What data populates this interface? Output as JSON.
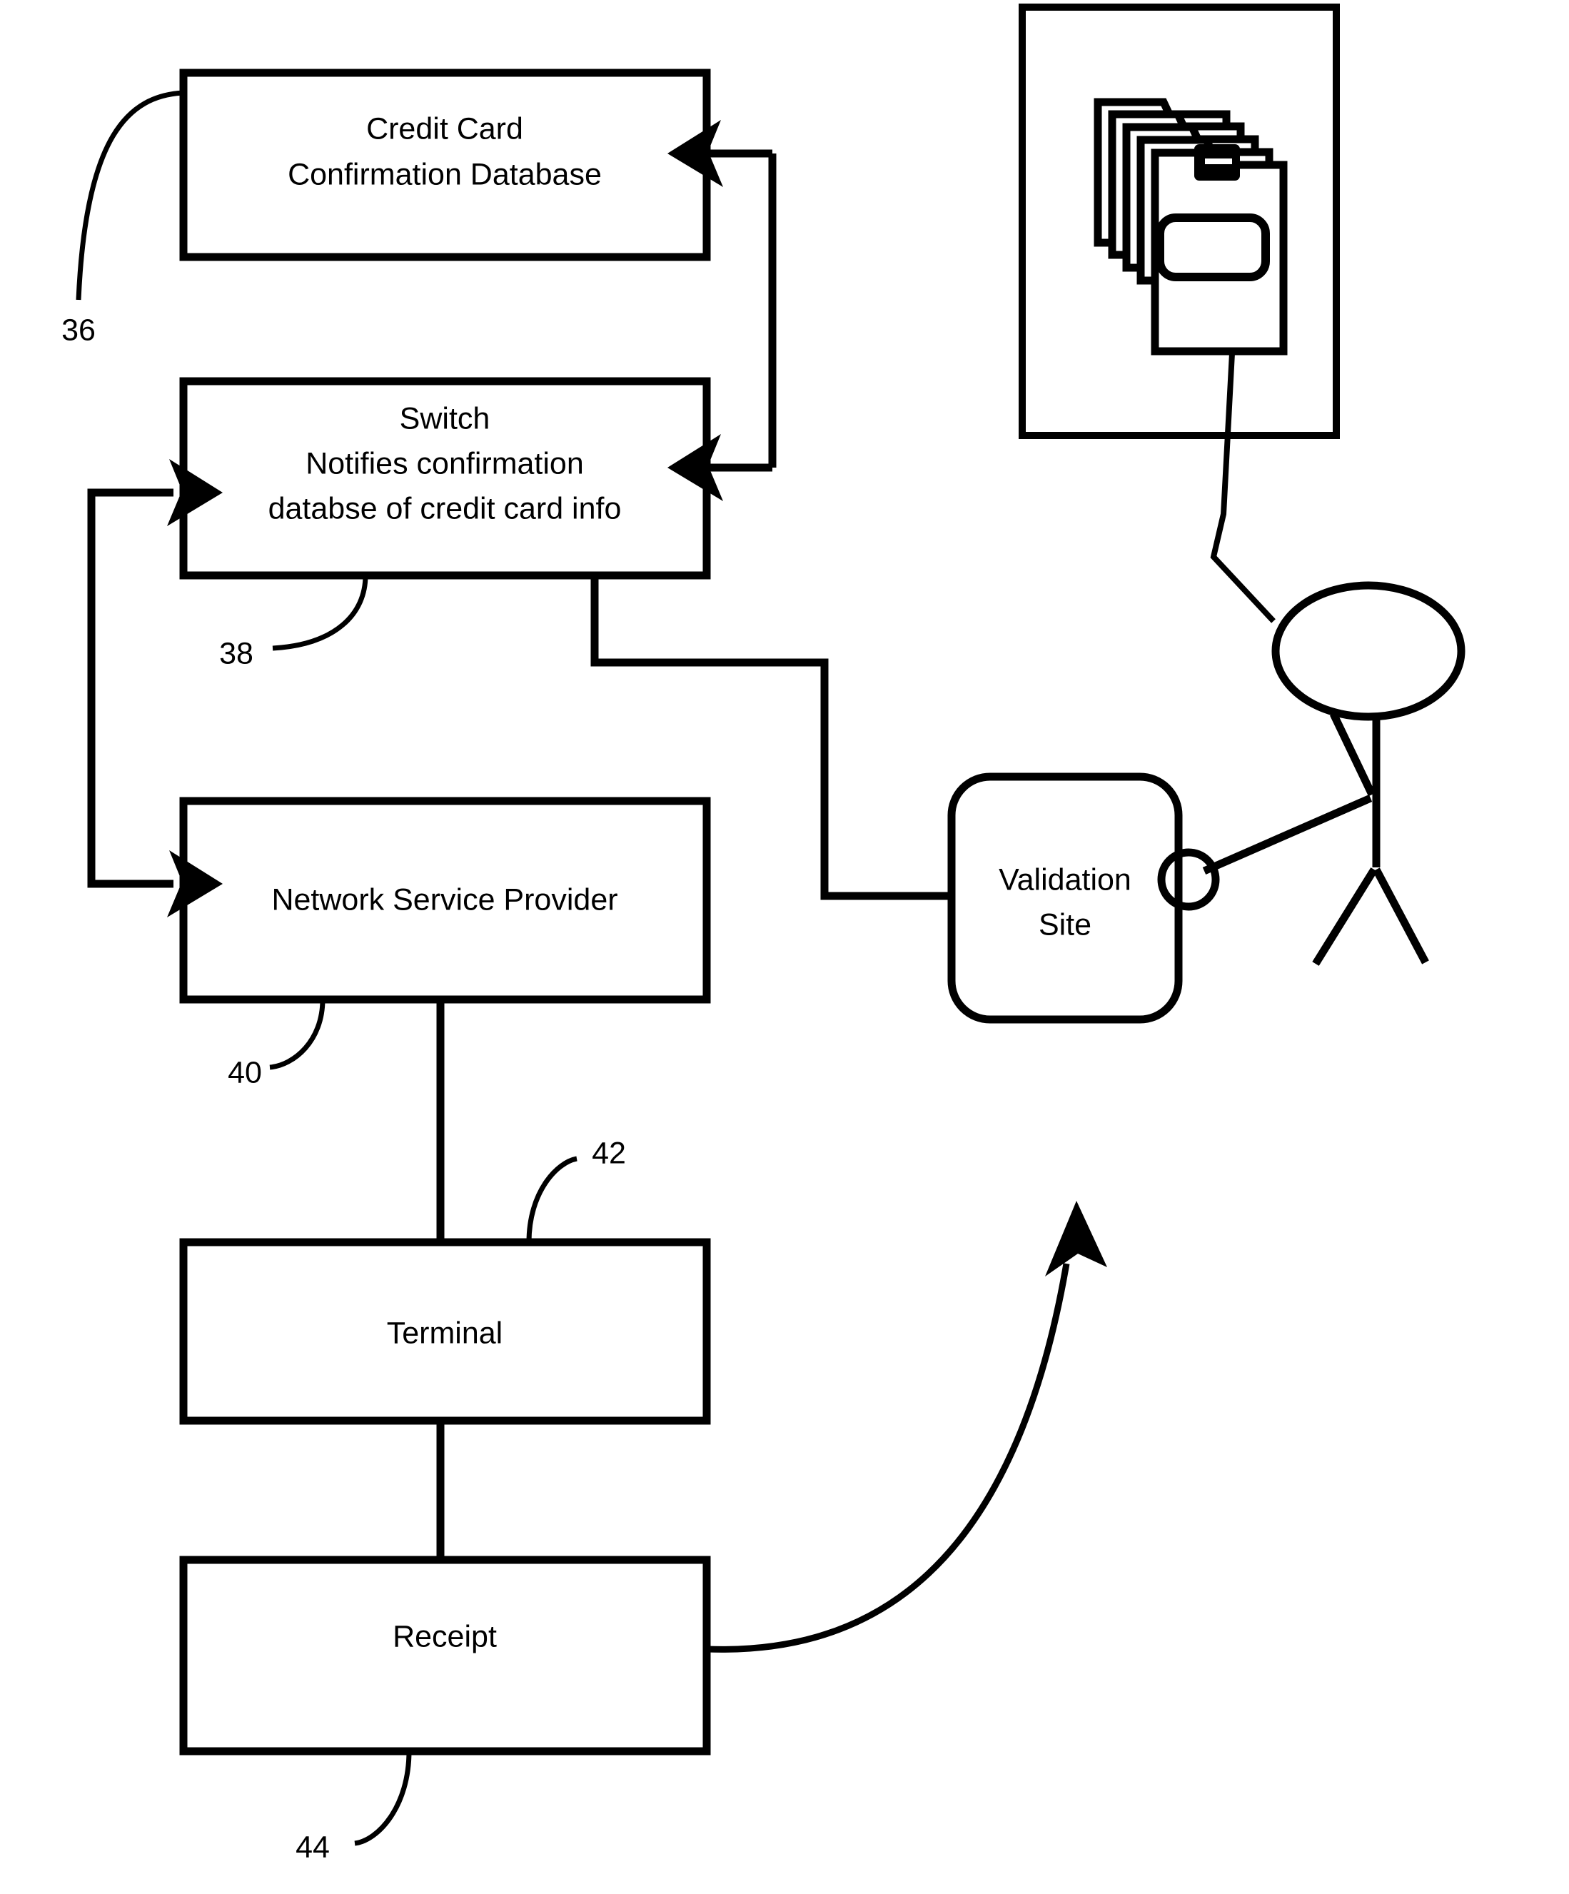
{
  "figure": {
    "type": "patent-flow-diagram",
    "background_color": "#ffffff",
    "line_color": "#000000"
  },
  "nodes": {
    "credit_card_db": {
      "label_line1": "Credit Card",
      "label_line2": "Confirmation Database",
      "ref": "36",
      "shape": "rectangle"
    },
    "switch": {
      "label_line1": "Switch",
      "label_line2": "Notifies confirmation",
      "label_line3": "databse of credit card info",
      "ref": "38",
      "shape": "rectangle"
    },
    "network_service_provider": {
      "label_line1": "Network Service Provider",
      "ref": "40",
      "shape": "rectangle"
    },
    "terminal": {
      "label_line1": "Terminal",
      "ref": "42",
      "shape": "rectangle"
    },
    "receipt": {
      "label_line1": "Receipt",
      "ref": "44",
      "shape": "rectangle"
    },
    "validation_site": {
      "label_line1": "Validation",
      "label_line2": "Site",
      "ref": "",
      "shape": "rounded-rectangle"
    }
  },
  "icons": {
    "document_stack": "file-folder-stack-icon",
    "person": "stick-figure-person-icon",
    "hand": "hand-circle-icon"
  },
  "reference_numerals": [
    "36",
    "38",
    "40",
    "42",
    "44"
  ],
  "edges": [
    {
      "from": "validation_site_loop",
      "to": "credit_card_db",
      "arrow": true
    },
    {
      "from": "validation_site_loop",
      "to": "switch",
      "arrow": true
    },
    {
      "from": "network_service_provider_return",
      "to": "switch",
      "arrow": true
    },
    {
      "from": "network_service_provider_return",
      "to": "network_service_provider",
      "arrow": true
    },
    {
      "from": "switch",
      "to": "validation_site",
      "arrow": false
    },
    {
      "from": "network_service_provider",
      "to": "terminal",
      "arrow": false
    },
    {
      "from": "terminal",
      "to": "receipt",
      "arrow": false
    },
    {
      "from": "receipt",
      "to": "validation_site_area",
      "arrow": true
    },
    {
      "from": "document_stack",
      "to": "person",
      "arrow": false
    },
    {
      "from": "validation_site",
      "to": "person_hand",
      "arrow": false
    }
  ]
}
